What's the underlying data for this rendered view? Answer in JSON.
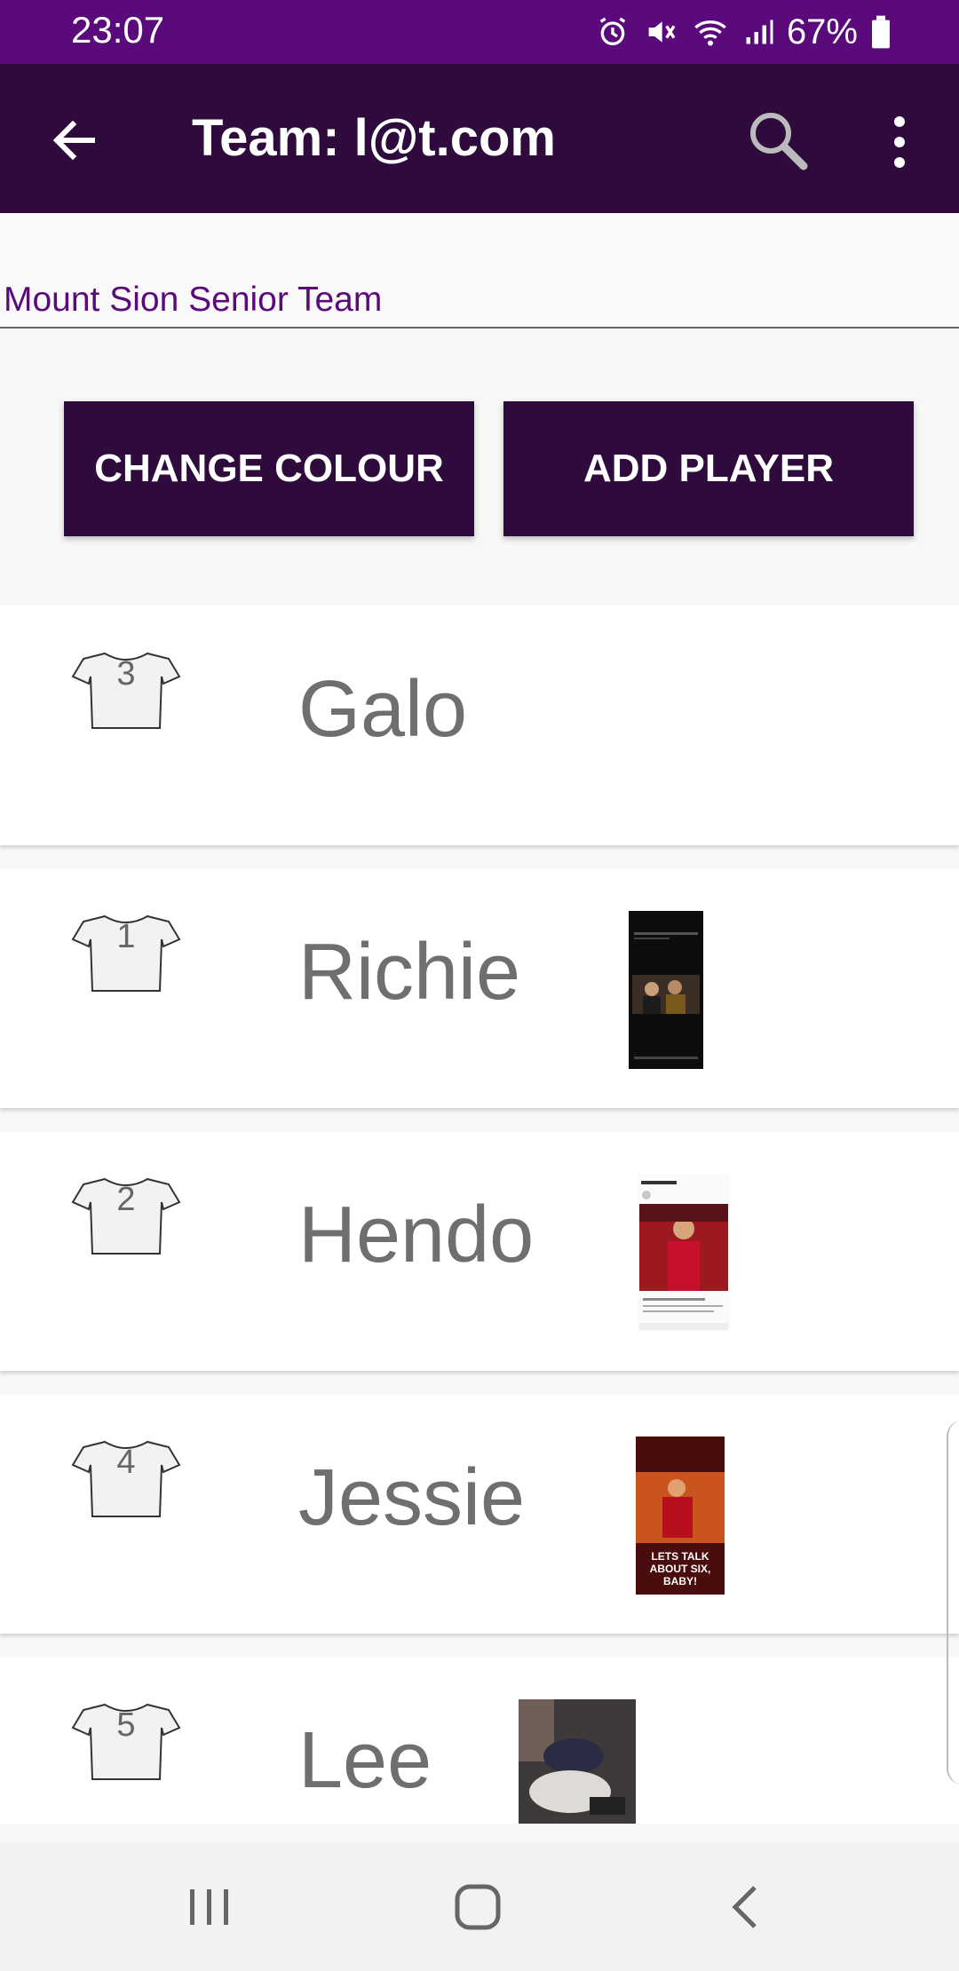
{
  "status_bar": {
    "time": "23:07",
    "battery": "67%",
    "icons": [
      "alarm-icon",
      "mute-icon",
      "wifi-icon",
      "signal-icon",
      "battery-icon"
    ]
  },
  "app_bar": {
    "title": "Team: l@t.com",
    "back_icon": "arrow-left-icon",
    "search_icon": "search-icon",
    "more_icon": "more-vert-icon"
  },
  "team_name": {
    "value": "Mount Sion Senior Team"
  },
  "actions": {
    "change_colour": "CHANGE COLOUR",
    "add_player": "ADD PLAYER"
  },
  "players": [
    {
      "number": "3",
      "name": "Galo",
      "has_image": false
    },
    {
      "number": "1",
      "name": "Richie",
      "has_image": true
    },
    {
      "number": "2",
      "name": "Hendo",
      "has_image": true
    },
    {
      "number": "4",
      "name": "Jessie",
      "has_image": true
    },
    {
      "number": "5",
      "name": "Lee",
      "has_image": true
    }
  ],
  "thumb_captions": {
    "jessie": "LETS TALK ABOUT SIX, BABY!"
  },
  "colors": {
    "status_bar": "#5a0a7a",
    "app_bar": "#2e0a3d",
    "accent_text": "#5a0a7a"
  },
  "nav_bar": [
    "recents-icon",
    "home-icon",
    "back-icon"
  ]
}
